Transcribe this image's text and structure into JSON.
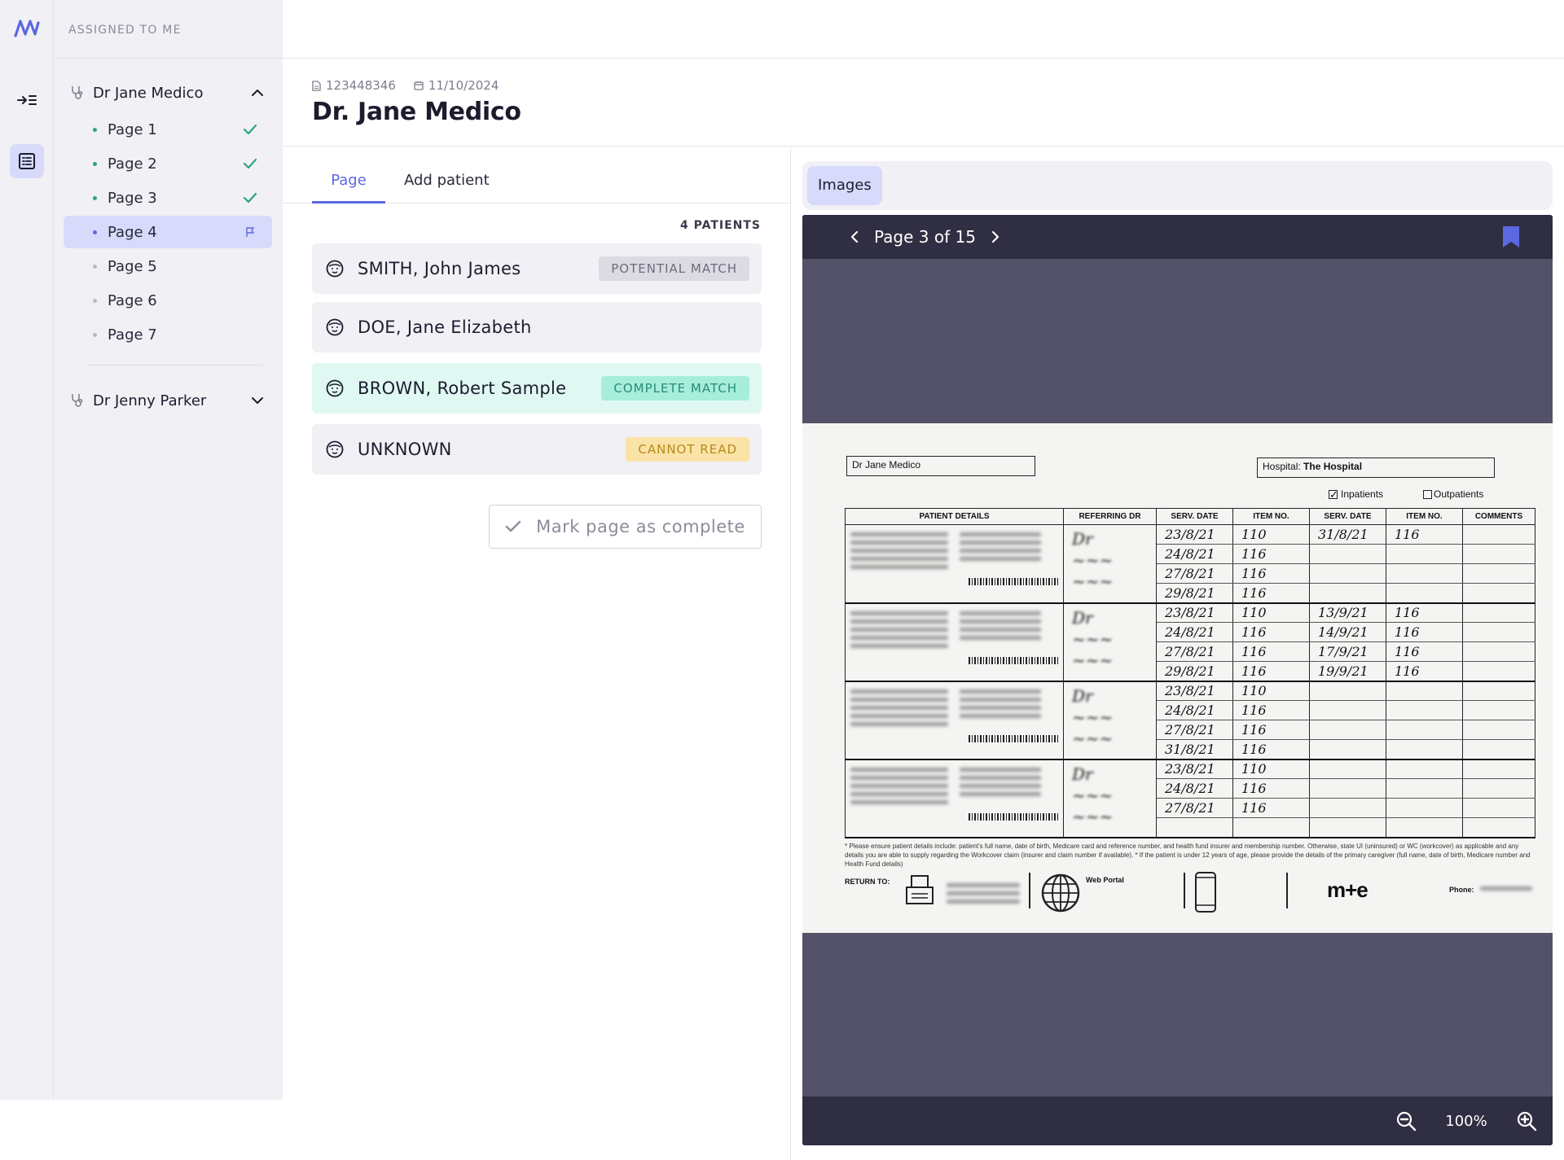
{
  "sidebar": {
    "section_title": "ASSIGNED TO ME",
    "doctors": [
      {
        "name": "Dr Jane Medico",
        "expanded": true,
        "pages": [
          {
            "label": "Page 1",
            "status": "complete"
          },
          {
            "label": "Page 2",
            "status": "complete"
          },
          {
            "label": "Page 3",
            "status": "complete"
          },
          {
            "label": "Page 4",
            "status": "flagged",
            "active": true
          },
          {
            "label": "Page 5",
            "status": "pending"
          },
          {
            "label": "Page 6",
            "status": "pending"
          },
          {
            "label": "Page 7",
            "status": "pending"
          }
        ]
      },
      {
        "name": "Dr Jenny Parker",
        "expanded": false
      }
    ]
  },
  "header": {
    "doc_id": "123448346",
    "date": "11/10/2024",
    "title": "Dr. Jane Medico"
  },
  "tabs": {
    "page": "Page",
    "add_patient": "Add patient"
  },
  "patients": {
    "count_label": "4 PATIENTS",
    "items": [
      {
        "name": "SMITH, John James",
        "badge": "POTENTIAL MATCH",
        "state": "potential"
      },
      {
        "name": "DOE, Jane Elizabeth",
        "badge": "",
        "state": "none"
      },
      {
        "name": "BROWN, Robert Sample",
        "badge": "COMPLETE MATCH",
        "state": "complete"
      },
      {
        "name": "UNKNOWN",
        "badge": "CANNOT READ",
        "state": "cannot"
      }
    ]
  },
  "actions": {
    "mark_complete": "Mark page as complete"
  },
  "viewer": {
    "tab_label": "Images",
    "pager": "Page 3 of 15",
    "zoom": "100%"
  },
  "document": {
    "doctor_box": "Dr Jane Medico",
    "hospital_label": "Hospital:",
    "hospital_value": "The Hospital",
    "inpatients": "Inpatients",
    "outpatients": "Outpatients",
    "columns": [
      "PATIENT DETAILS",
      "REFERRING DR",
      "SERV. DATE",
      "ITEM NO.",
      "SERV. DATE",
      "ITEM NO.",
      "COMMENTS"
    ],
    "rows": [
      [
        "23/8/21",
        "110",
        "31/8/21",
        "116"
      ],
      [
        "24/8/21",
        "116",
        "",
        ""
      ],
      [
        "27/8/21",
        "116",
        "",
        ""
      ],
      [
        "29/8/21",
        "116",
        "",
        ""
      ],
      [
        "23/8/21",
        "110",
        "13/9/21",
        "116"
      ],
      [
        "24/8/21",
        "116",
        "14/9/21",
        "116"
      ],
      [
        "27/8/21",
        "116",
        "17/9/21",
        "116"
      ],
      [
        "29/8/21",
        "116",
        "19/9/21",
        "116"
      ],
      [
        "23/8/21",
        "110",
        "",
        ""
      ],
      [
        "24/8/21",
        "116",
        "",
        ""
      ],
      [
        "27/8/21",
        "116",
        "",
        ""
      ],
      [
        "31/8/21",
        "116",
        "",
        ""
      ],
      [
        "23/8/21",
        "110",
        "",
        ""
      ],
      [
        "24/8/21",
        "116",
        "",
        ""
      ],
      [
        "27/8/21",
        "116",
        "",
        ""
      ],
      [
        "",
        "",
        "",
        ""
      ]
    ],
    "footnote": "* Please ensure patient details include: patient's full name, date of birth, Medicare card and reference number, and health fund insurer and membership number. Otherwise, state UI (uninsured) or WC (workcover) as applicable and any details you are able to supply regarding the Workcover claim (insurer and claim number if available). * If the patient is under 12 years of age, please provide the details of the primary caregiver (full name, date of birth, Medicare number and Health Fund details)",
    "return_to": "RETURN TO:",
    "web_portal": "Web Portal",
    "phone": "Phone:"
  },
  "colors": {
    "accent": "#5b68e0",
    "active_bg": "#d7dafb",
    "complete_check": "#2aa57c",
    "viewer_bg": "#535268",
    "viewer_bar": "#2f2e42"
  }
}
